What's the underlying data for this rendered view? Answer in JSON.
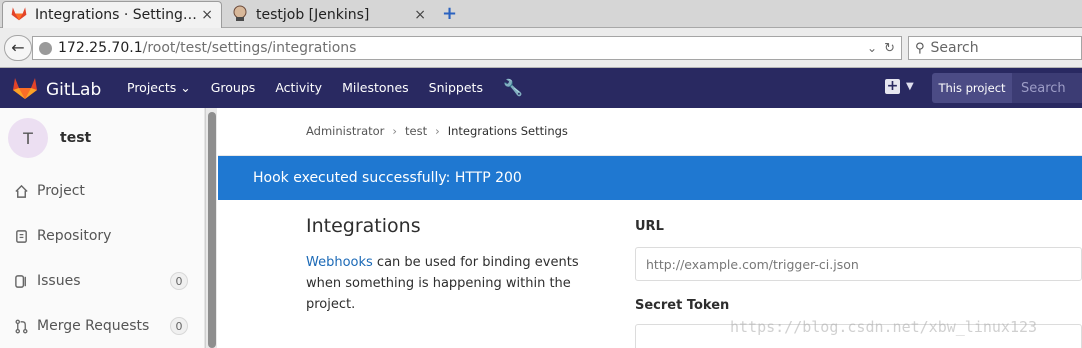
{
  "browser": {
    "tabs": [
      {
        "title": "Integrations · Setting…",
        "close": "×"
      },
      {
        "title": "testjob [Jenkins]",
        "close": "×"
      }
    ],
    "new_tab": "+",
    "url_host": "172.25.70.1",
    "url_path": "/root/test/settings/integrations",
    "search_placeholder": "Search"
  },
  "header": {
    "brand": "GitLab",
    "nav": [
      "Projects ⌄",
      "Groups",
      "Activity",
      "Milestones",
      "Snippets"
    ],
    "search_scope": "This project",
    "search_placeholder": "Search",
    "colors": {
      "background": "#292961",
      "flash": "#1f78d1"
    }
  },
  "sidebar": {
    "avatar_letter": "T",
    "project_name": "test",
    "items": [
      {
        "label": "Project",
        "icon": "home-icon"
      },
      {
        "label": "Repository",
        "icon": "repository-icon"
      },
      {
        "label": "Issues",
        "icon": "issues-icon",
        "count": "0"
      },
      {
        "label": "Merge Requests",
        "icon": "merge-request-icon",
        "count": "0"
      }
    ]
  },
  "breadcrumb": [
    "Administrator",
    "test",
    "Integrations Settings"
  ],
  "flash": "Hook executed successfully: HTTP 200",
  "section": {
    "title": "Integrations",
    "desc_link": "Webhooks",
    "desc_rest": " can be used for binding events when something is happening within the project."
  },
  "form": {
    "url_label": "URL",
    "url_placeholder": "http://example.com/trigger-ci.json",
    "secret_label": "Secret Token"
  },
  "watermark": "https://blog.csdn.net/xbw_linux123"
}
